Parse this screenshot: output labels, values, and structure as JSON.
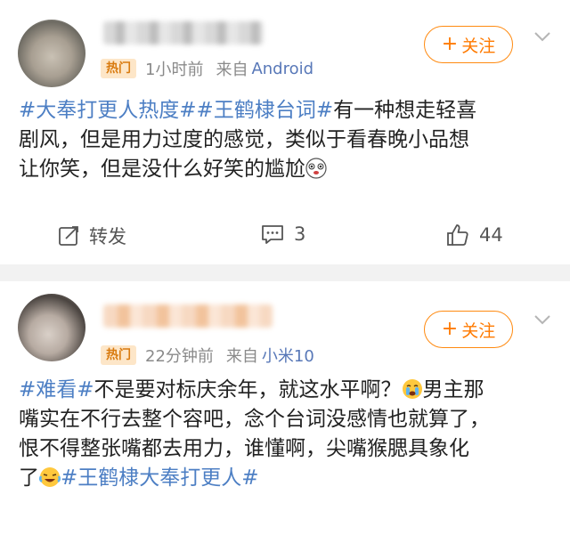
{
  "posts": [
    {
      "badge": "热门",
      "time": "1小时前",
      "source_prefix": "来自",
      "source": "Android",
      "follow_label": "关注",
      "content": {
        "tag1": "#大奉打更人热度#",
        "tag2": "#王鹤棣台词#",
        "line1_rest": "有一种想走轻喜",
        "line2": "剧风，但是用力过度的感觉，类似于看春晚小品想",
        "line3": "让你笑，但是没什么好笑的尴尬"
      },
      "actions": {
        "repost_label": "转发",
        "comment_count": "3",
        "like_count": "44"
      }
    },
    {
      "badge": "热门",
      "time": "22分钟前",
      "source_prefix": "来自",
      "source": "小米10",
      "follow_label": "关注",
      "content": {
        "tag1": "#难看#",
        "line1_rest": "不是要对标庆余年，就这水平啊？",
        "line1_end": "男主那",
        "line2": "嘴实在不行去整个容吧，念个台词没感情也就算了，",
        "line3": "恨不得整张嘴都去用力，谁懂啊，尖嘴猴腮具象化",
        "line4_start": "了",
        "tag2": "#王鹤棣大奉打更人#"
      }
    }
  ],
  "icons": {
    "follow": "plus-icon",
    "more": "chevron-down-icon",
    "repost": "repost-icon",
    "comment": "comment-icon",
    "like": "thumbs-up-icon"
  },
  "colors": {
    "accent": "#ff7a00",
    "link": "#4d7fc4",
    "badge_bg": "#fde6c8",
    "badge_text": "#d97b10"
  }
}
